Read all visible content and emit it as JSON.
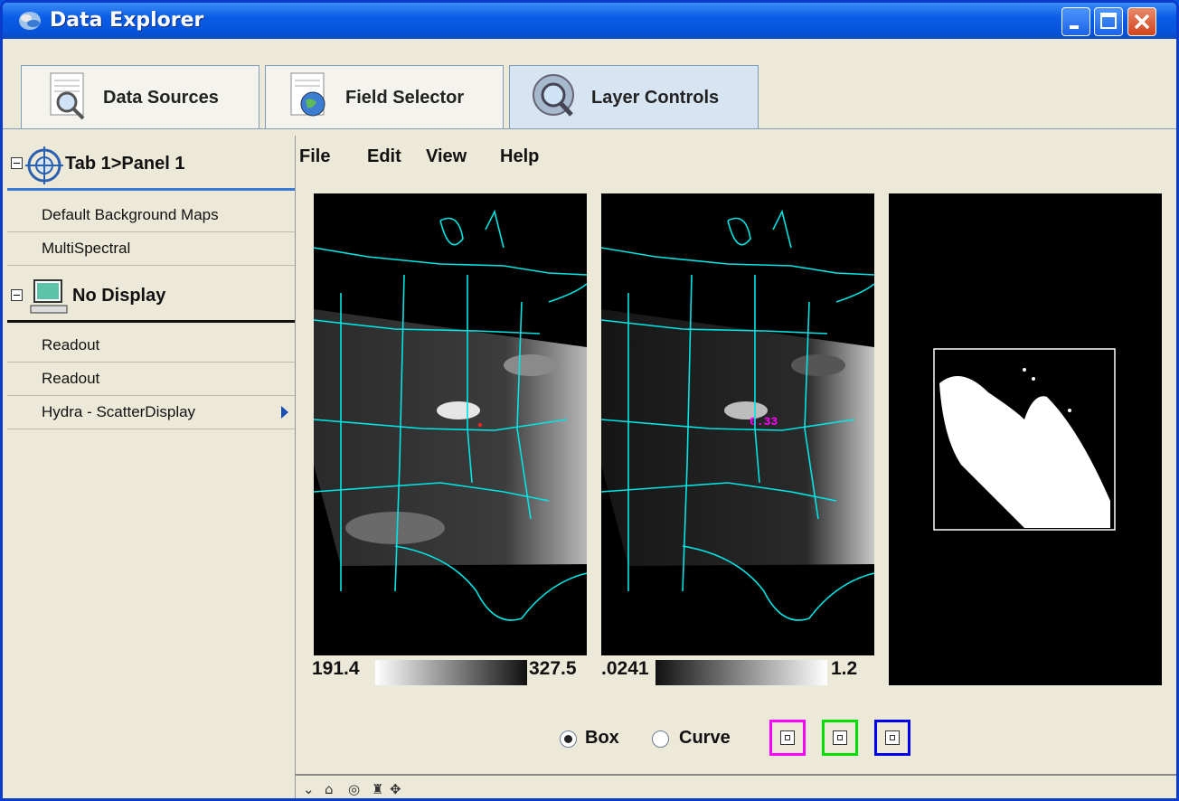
{
  "window": {
    "title": "Data Explorer"
  },
  "tabs": [
    {
      "label": "Data Sources",
      "icon": "data-sources-icon"
    },
    {
      "label": "Field Selector",
      "icon": "field-selector-icon"
    },
    {
      "label": "Layer Controls",
      "icon": "layer-controls-icon",
      "active": true
    }
  ],
  "sidebar": {
    "group1": {
      "label": "Tab 1>Panel 1",
      "icon": "map-view-icon"
    },
    "group1_items": [
      "Default Background Maps",
      "MultiSpectral"
    ],
    "group2": {
      "label": "No Display",
      "icon": "computer-display-icon"
    },
    "group2_items": [
      "Readout",
      "Readout",
      "Hydra - ScatterDisplay"
    ]
  },
  "menu": [
    "File",
    "Edit",
    "View",
    "Help"
  ],
  "panels": {
    "left_colorbar": {
      "min": "191.4",
      "max": "327.5"
    },
    "mid_colorbar": {
      "min": ".0241",
      "max": "1.2"
    },
    "mid_readout": "0.33"
  },
  "controls": {
    "box_label": "Box",
    "curve_label": "Curve",
    "selected": "Box",
    "selector_colors": [
      "#ff00ff",
      "#00dd00",
      "#0000ee"
    ]
  },
  "colors": {
    "accent": "#0a5de6",
    "map_lines": "#00e5e5",
    "readout": "#ff00ff"
  }
}
